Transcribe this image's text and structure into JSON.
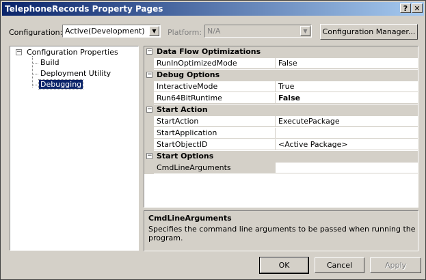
{
  "window": {
    "title": "TelephoneRecords Property Pages"
  },
  "toolbar": {
    "configuration_label": "Configuration:",
    "configuration_value": "Active(Development)",
    "platform_label": "Platform:",
    "platform_value": "N/A",
    "config_manager_label": "Configuration Manager..."
  },
  "tree": {
    "root": "Configuration Properties",
    "items": [
      "Build",
      "Deployment Utility",
      "Debugging"
    ],
    "selected": "Debugging"
  },
  "grid": {
    "categories": [
      {
        "name": "Data Flow Optimizations",
        "rows": [
          {
            "name": "RunInOptimizedMode",
            "value": "False",
            "bold": false
          }
        ]
      },
      {
        "name": "Debug Options",
        "rows": [
          {
            "name": "InteractiveMode",
            "value": "True",
            "bold": false
          },
          {
            "name": "Run64BitRuntime",
            "value": "False",
            "bold": true
          }
        ]
      },
      {
        "name": "Start Action",
        "rows": [
          {
            "name": "StartAction",
            "value": "ExecutePackage",
            "bold": false
          },
          {
            "name": "StartApplication",
            "value": "",
            "bold": false
          },
          {
            "name": "StartObjectID",
            "value": "<Active Package>",
            "bold": false
          }
        ]
      },
      {
        "name": "Start Options",
        "rows": [
          {
            "name": "CmdLineArguments",
            "value": "",
            "bold": false
          }
        ]
      }
    ]
  },
  "description": {
    "title": "CmdLineArguments",
    "text": "Specifies the command line arguments to be passed when running the program."
  },
  "buttons": {
    "ok": "OK",
    "cancel": "Cancel",
    "apply": "Apply"
  },
  "icons": {
    "help": "?",
    "close": "✕",
    "expand_minus": "−",
    "dropdown": "▼"
  }
}
